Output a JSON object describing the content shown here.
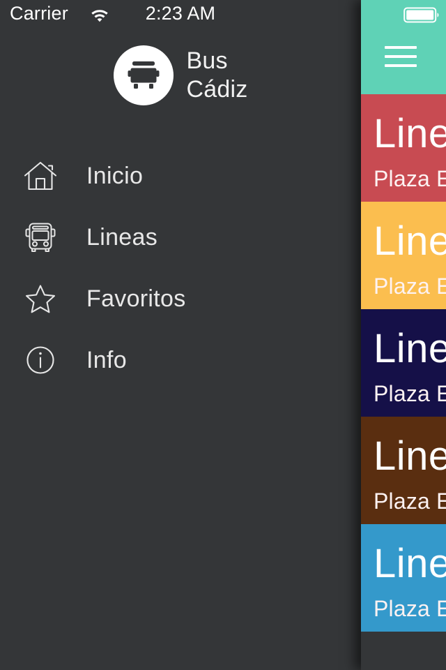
{
  "status_bar": {
    "carrier": "Carrier",
    "wifi_icon": "wifi-icon",
    "time": "2:23 AM",
    "battery_icon": "battery-full-icon"
  },
  "drawer": {
    "brand": {
      "logo_icon": "bus-logo-icon",
      "title": "Bus\nCádiz"
    },
    "items": [
      {
        "label": "Inicio",
        "icon": "home-icon"
      },
      {
        "label": "Lineas",
        "icon": "bus-icon"
      },
      {
        "label": "Favoritos",
        "icon": "star-icon"
      },
      {
        "label": "Info",
        "icon": "info-icon"
      }
    ]
  },
  "content": {
    "header": {
      "menu_icon": "hamburger-menu-icon",
      "background_color": "#5fd2b6"
    },
    "lines": [
      {
        "title": "Linea",
        "subtitle": "Plaza E",
        "color": "#c84b52"
      },
      {
        "title": "Linea",
        "subtitle": "Plaza E",
        "color": "#fbbe4f"
      },
      {
        "title": "Linea",
        "subtitle": "Plaza E",
        "color": "#151048"
      },
      {
        "title": "Linea",
        "subtitle": "Plaza E",
        "color": "#5a2e10"
      },
      {
        "title": "Linea",
        "subtitle": "Plaza E",
        "color": "#3499cb"
      }
    ]
  },
  "colors": {
    "drawer_background": "#343638",
    "accent_teal": "#5fd2b6",
    "text_primary": "#ffffff"
  }
}
